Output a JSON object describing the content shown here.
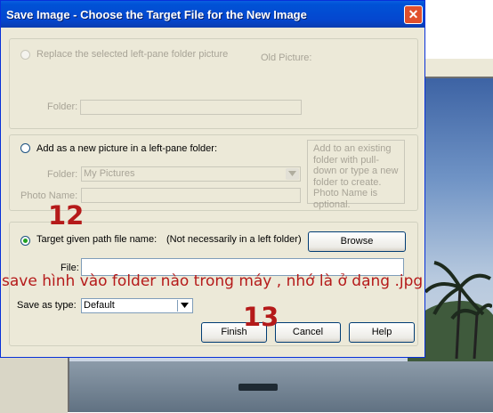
{
  "dialog": {
    "title": "Save Image - Choose the Target File for the New Image",
    "close_label": "✕"
  },
  "group_replace": {
    "radio_label": "Replace the selected left-pane folder picture",
    "old_picture_label": "Old Picture:",
    "folder_label": "Folder:",
    "folder_value": ""
  },
  "group_add": {
    "radio_label": "Add as a new picture in a left-pane folder:",
    "folder_label": "Folder:",
    "folder_value": "My Pictures",
    "photo_name_label": "Photo Name:",
    "photo_name_value": "",
    "info_text": "Add to an existing folder with pull-down or type a new folder to create.   Photo Name is optional."
  },
  "group_target": {
    "radio_label": "Target given path file name:",
    "hint": "(Not necessarily in a left folder)",
    "browse_label": "Browse",
    "file_label": "File:",
    "file_value": "",
    "selected": true
  },
  "save_as": {
    "label": "Save as type:",
    "value": "Default"
  },
  "buttons": {
    "finish": "Finish",
    "cancel": "Cancel",
    "help": "Help"
  },
  "annotations": {
    "step12": "12",
    "step13": "13",
    "note": "save hình vào folder nào trong máy , nhớ là ở dạng .jpg"
  },
  "icons": [
    "close-icon",
    "dropdown-arrow-icon",
    "radio-icon"
  ],
  "colors": {
    "titlebar": "#0447cf",
    "dialog_bg": "#ece9d8",
    "annotation": "#b51a1a",
    "close_button": "#e1502c"
  }
}
